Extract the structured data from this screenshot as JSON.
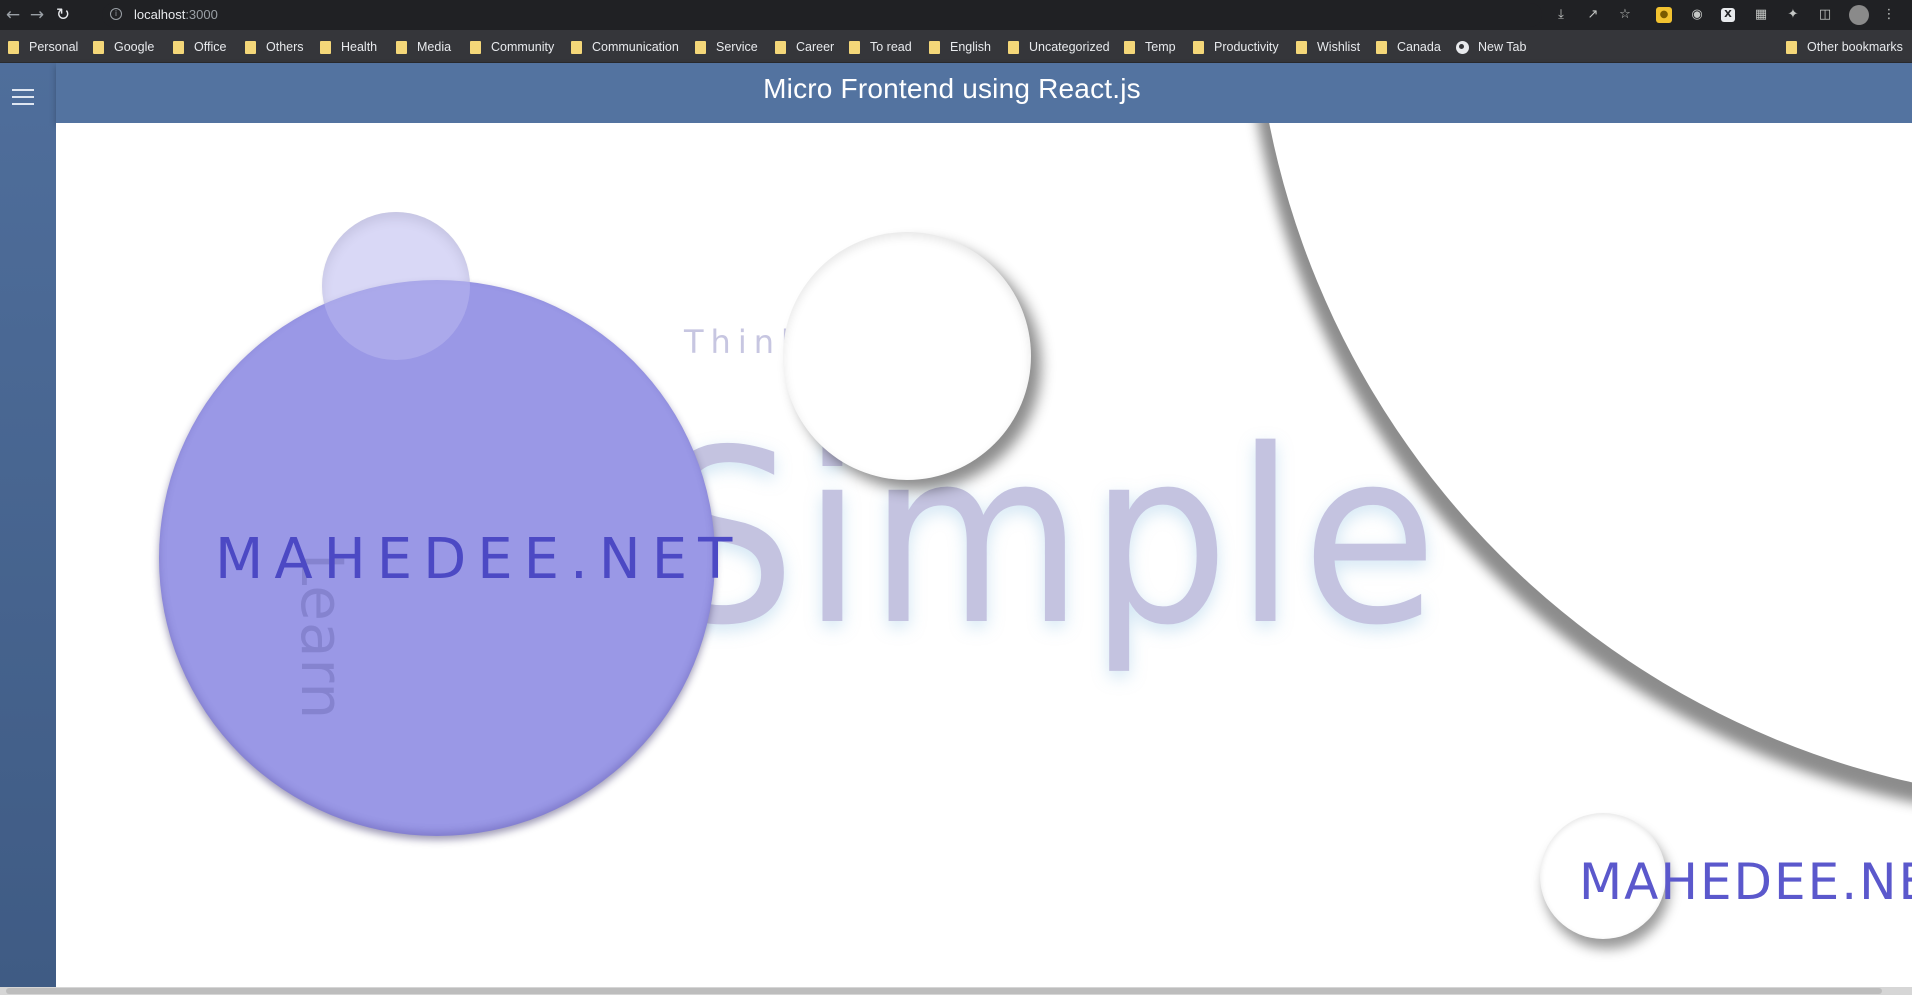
{
  "browser": {
    "url_host": "localhost",
    "url_port": ":3000",
    "bookmarks": [
      "Personal",
      "Google",
      "Office",
      "Others",
      "Health",
      "Media",
      "Community",
      "Communication",
      "Service",
      "Career",
      "To read",
      "English",
      "Uncategorized",
      "Temp",
      "Productivity",
      "Wishlist",
      "Canada",
      "New Tab"
    ],
    "other_bookmarks": "Other bookmarks"
  },
  "app": {
    "title": "Micro Frontend using React.js",
    "menu_icon": "hamburger-icon"
  },
  "hero": {
    "think": "Think",
    "simple": "Simple",
    "learn": "Learn",
    "brand_center": "MAHEDEE.NET",
    "brand_corner": "MAHEDEE.NET"
  },
  "colors": {
    "header": "#5373a0",
    "sidebar": "#46648f",
    "purple_circle": "#9a98e6",
    "brand_text": "#4c49c4",
    "simple_text": "#c4c3e0"
  }
}
